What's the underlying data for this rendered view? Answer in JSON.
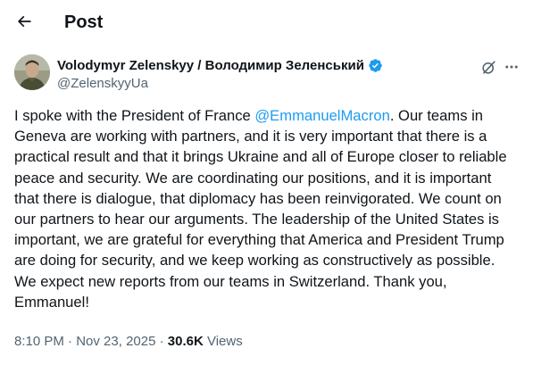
{
  "header": {
    "back_icon": "arrow-left-icon",
    "title": "Post"
  },
  "author": {
    "name": "Volodymyr Zelenskyy / Володимир Зеленський",
    "handle": "@ZelenskyyUa",
    "verified_color": "#1d9bf0"
  },
  "actions": {
    "grok_icon": "grok-icon",
    "more_icon": "more-icon"
  },
  "tweet": {
    "text_before_mention": "I spoke with the President of France ",
    "mention": "@EmmanuelMacron",
    "text_after_mention": ". Our teams in Geneva are working with partners, and it is very important that there is a practical result and that it brings Ukraine and all of Europe closer to reliable peace and security. We are coordinating our positions, and it is important that there is dialogue, that diplomacy has been reinvigorated. We count on our partners to hear our arguments. The leadership of the United States is important, we are grateful for everything that America and President Trump are doing for security, and we keep working as constructively as possible. We expect new reports from our teams in Switzerland. Thank you, Emmanuel!"
  },
  "meta": {
    "time": "8:10 PM",
    "separator": " · ",
    "date": "Nov 23, 2025",
    "views_count": "30.6K",
    "views_label": " Views"
  },
  "colors": {
    "link": "#1d9bf0",
    "secondary_text": "#536471",
    "primary_text": "#0f1419"
  }
}
